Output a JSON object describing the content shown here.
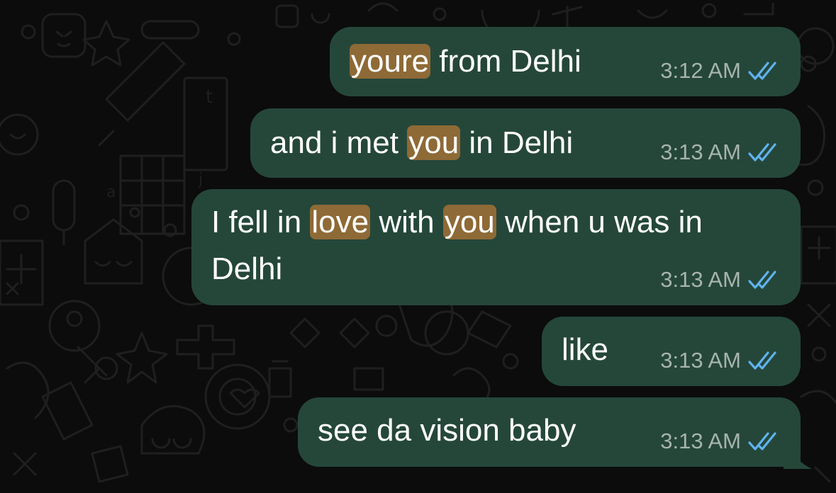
{
  "colors": {
    "background": "#0c0c0c",
    "bubble": "#25473a",
    "highlight": "#8e6a36",
    "timestamp": "#a7b3ae",
    "read_ticks": "#5fb2ee"
  },
  "messages": [
    {
      "segments": [
        {
          "text": "youre",
          "highlight": true
        },
        {
          "text": " from Delhi",
          "highlight": false
        }
      ],
      "time": "3:12 AM",
      "status": "read"
    },
    {
      "segments": [
        {
          "text": "and i met ",
          "highlight": false
        },
        {
          "text": "you",
          "highlight": true
        },
        {
          "text": " in Delhi",
          "highlight": false
        }
      ],
      "time": "3:13 AM",
      "status": "read"
    },
    {
      "line1": [
        {
          "text": "I fell in ",
          "highlight": false
        },
        {
          "text": "love",
          "highlight": true
        },
        {
          "text": " with ",
          "highlight": false
        },
        {
          "text": "you",
          "highlight": true
        },
        {
          "text": " when u was in",
          "highlight": false
        }
      ],
      "line2": "Delhi",
      "time": "3:13 AM",
      "status": "read"
    },
    {
      "text": "like",
      "time": "3:13 AM",
      "status": "read"
    },
    {
      "text": "see da vision baby",
      "time": "3:13 AM",
      "status": "read"
    }
  ],
  "icons": {
    "read_receipt": "double-check-icon"
  }
}
